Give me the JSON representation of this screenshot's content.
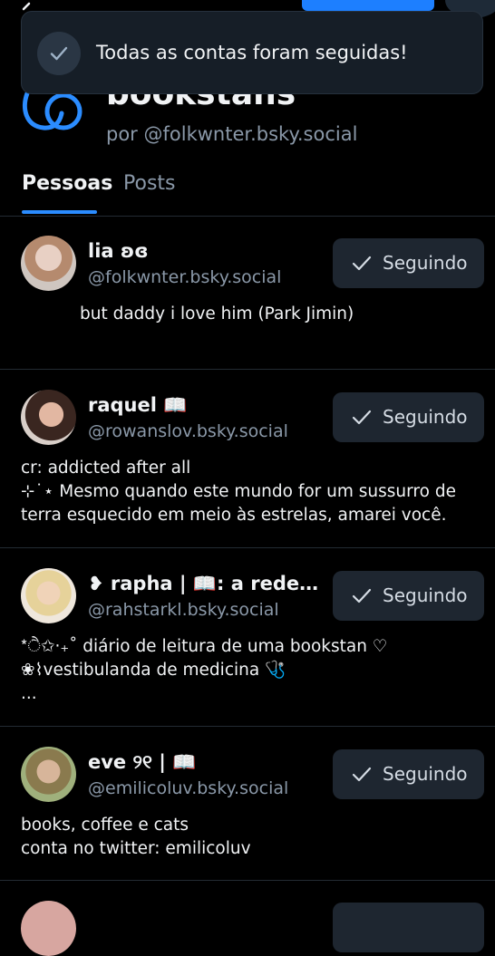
{
  "toast": {
    "message": "Todas as contas foram seguidas!",
    "icon": "check-icon"
  },
  "top": {
    "button_label": ""
  },
  "list": {
    "title": "bookstans",
    "author_prefix": "por",
    "author_handle": "@folkwnter.bsky.social",
    "accent_color": "#2b8cff"
  },
  "tabs": [
    {
      "label": "Pessoas",
      "active": true
    },
    {
      "label": "Posts",
      "active": false
    }
  ],
  "people": [
    {
      "name": "lia ʚɞ",
      "handle": "@folkwnter.bsky.social",
      "button": "Seguindo",
      "bio": "but daddy i love him (Park Jimin)"
    },
    {
      "name": "raquel 📖",
      "handle": "@rowanslov.bsky.social",
      "button": "Seguindo",
      "bio": "cr: addicted after all\n⊹˙⋆ Mesmo quando este mundo for um sussurro de\nterra esquecido em meio às estrelas, amarei você."
    },
    {
      "name": "❥ rapha | 📖: a redenç...",
      "handle": "@rahstarkl.bsky.social",
      "button": "Seguindo",
      "bio": "*ੈ✩‧₊˚ diário de leitura de uma bookstan ♡\n❀⌇vestibulanda de medicina 🩺\n..."
    },
    {
      "name": "eve ୨୧ | 📖",
      "handle": "@emilicoluv.bsky.social",
      "button": "Seguindo",
      "bio": "books, coffee e cats\nconta no twitter: emilicoluv"
    }
  ]
}
